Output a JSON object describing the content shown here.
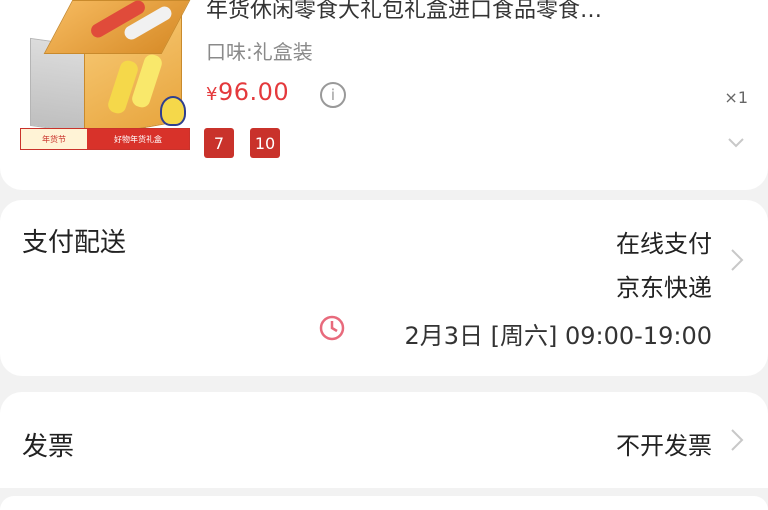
{
  "product": {
    "title": "年货休闲零食大礼包礼盒进口食品零食…",
    "spec": "口味:礼盒装",
    "price_currency": "¥",
    "price_value": "96.00",
    "quantity": "×1",
    "badges": [
      "7",
      "10"
    ],
    "promo_left": "年货节",
    "promo_right": "好物年货礼盒"
  },
  "delivery": {
    "label": "支付配送",
    "payment": "在线支付",
    "courier": "京东快递",
    "time": "2月3日 [周六] 09:00-19:00"
  },
  "invoice": {
    "label": "发票",
    "value": "不开发票"
  },
  "icons": {
    "info": "info-icon",
    "chevron": "chevron-right-icon",
    "clock": "clock-icon",
    "expand": "chevron-down-icon"
  },
  "colors": {
    "price": "#e4393c",
    "badge": "#c9322b",
    "clock": "#e86a7c"
  }
}
